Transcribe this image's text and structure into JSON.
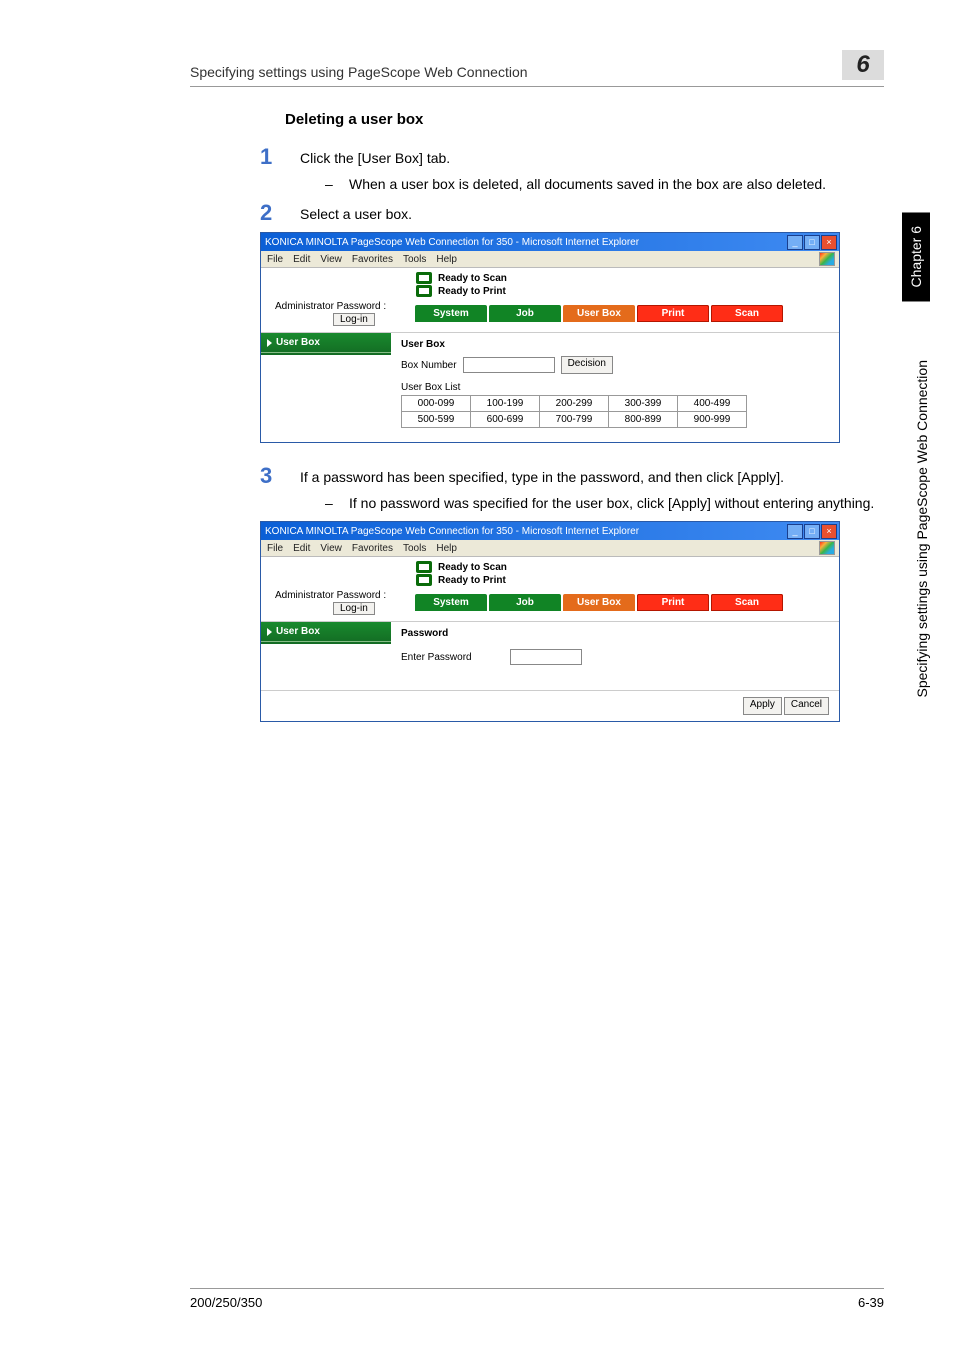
{
  "header": {
    "title": "Specifying settings using PageScope Web Connection",
    "chapter_number": "6"
  },
  "section_title": "Deleting a user box",
  "steps": {
    "s1": {
      "num": "1",
      "text": "Click the [User Box] tab.",
      "sub": "When a user box is deleted, all documents saved in the box are also deleted."
    },
    "s2": {
      "num": "2",
      "text": "Select a user box."
    },
    "s3": {
      "num": "3",
      "text": "If a password has been specified, type in the password, and then click [Apply].",
      "sub": "If no password was specified for the user box, click [Apply] without entering anything."
    }
  },
  "ie": {
    "title": "KONICA MINOLTA PageScope Web Connection for 350 - Microsoft Internet Explorer",
    "menu": [
      "File",
      "Edit",
      "View",
      "Favorites",
      "Tools",
      "Help"
    ],
    "status1": "Ready to Scan",
    "status2": "Ready to Print",
    "admin_label": "Administrator Password :",
    "login": "Log-in",
    "tabs": [
      "System",
      "Job",
      "User Box",
      "Print",
      "Scan"
    ],
    "sidebar_item": "User Box"
  },
  "panel1": {
    "title": "User Box",
    "boxnum_label": "Box Number",
    "decision": "Decision",
    "list_label": "User Box List",
    "ranges_row1": [
      "000-099",
      "100-199",
      "200-299",
      "300-399",
      "400-499"
    ],
    "ranges_row2": [
      "500-599",
      "600-699",
      "700-799",
      "800-899",
      "900-999"
    ]
  },
  "panel2": {
    "title": "Password",
    "enter_pw": "Enter Password",
    "apply": "Apply",
    "cancel": "Cancel"
  },
  "side": {
    "chapter": "Chapter 6",
    "long": "Specifying settings using PageScope Web Connection"
  },
  "footer": {
    "left": "200/250/350",
    "right": "6-39"
  },
  "dash": "–"
}
